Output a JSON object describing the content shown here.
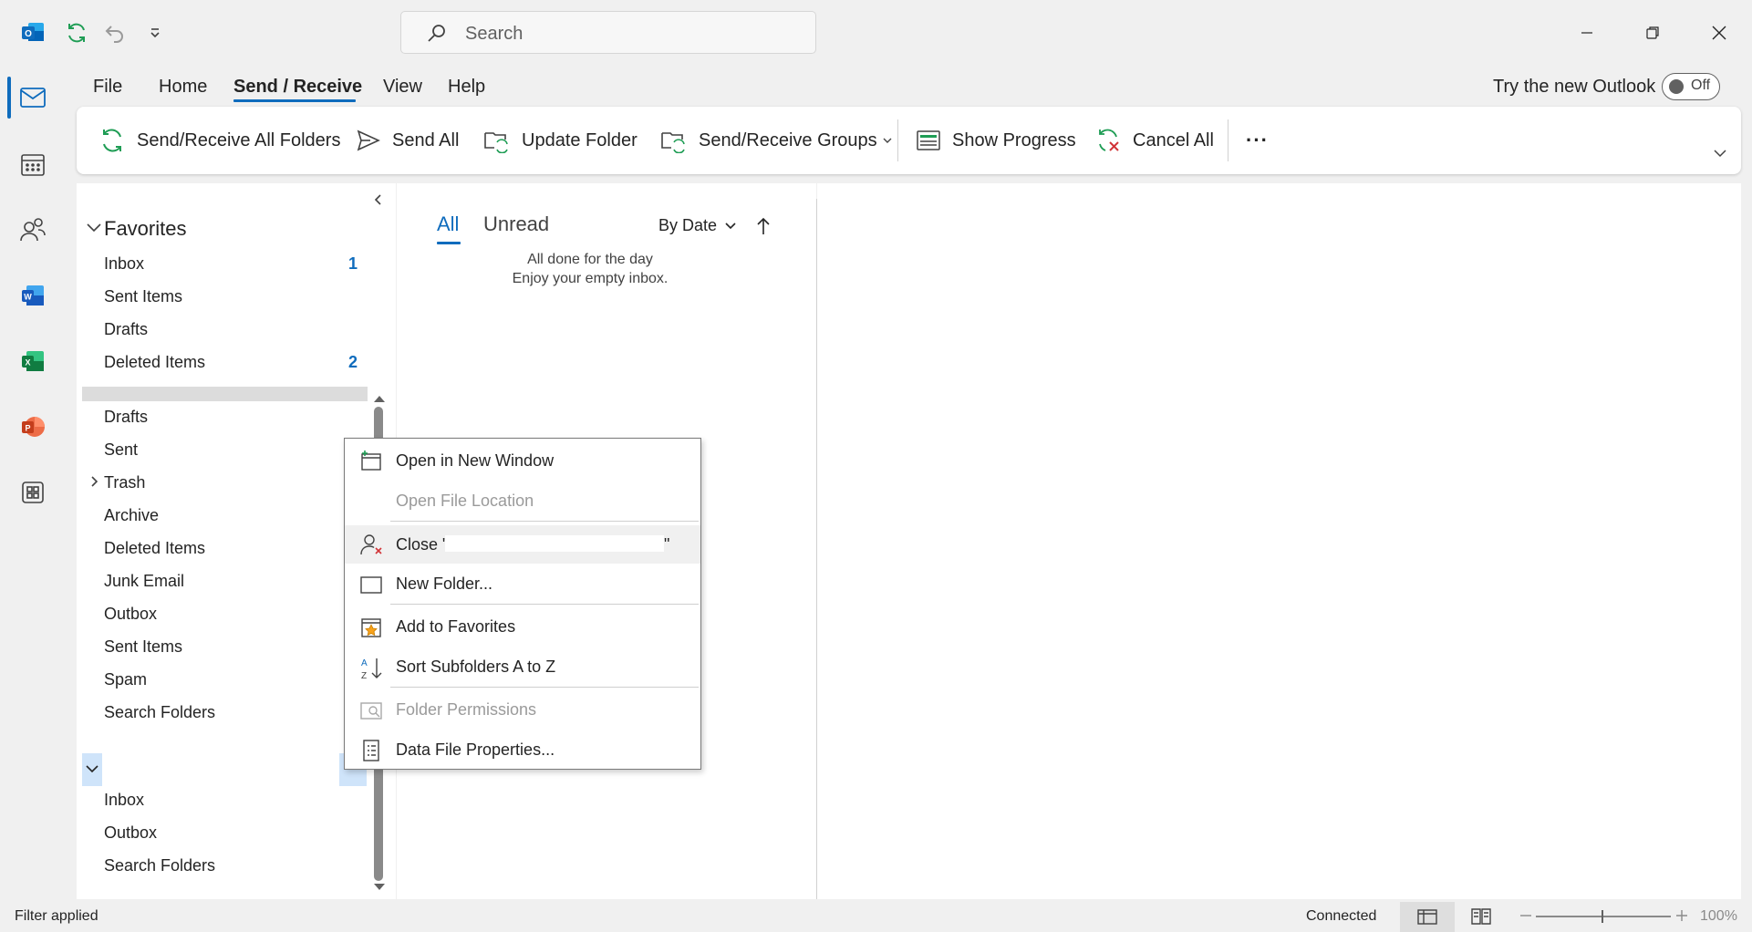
{
  "search": {
    "placeholder": "Search"
  },
  "menu": {
    "tabs": [
      "File",
      "Home",
      "Send / Receive",
      "View",
      "Help"
    ],
    "try_new_outlook": "Try the new Outlook",
    "toggle_label": "Off"
  },
  "ribbon": {
    "send_receive_all": "Send/Receive All Folders",
    "send_all": "Send All",
    "update_folder": "Update Folder",
    "send_receive_groups": "Send/Receive Groups",
    "show_progress": "Show Progress",
    "cancel_all": "Cancel All",
    "more": "···"
  },
  "folders": {
    "favorites_header": "Favorites",
    "favorites": [
      {
        "label": "Inbox",
        "count": "1"
      },
      {
        "label": "Sent Items",
        "count": ""
      },
      {
        "label": "Drafts",
        "count": ""
      },
      {
        "label": "Deleted Items",
        "count": "2"
      }
    ],
    "account1": [
      "Drafts",
      "Sent",
      "Trash",
      "Archive",
      "Deleted Items",
      "Junk Email",
      "Outbox",
      "Sent Items",
      "Spam",
      "Search Folders"
    ],
    "account2": [
      "Inbox",
      "Outbox",
      "Search Folders"
    ]
  },
  "message_list": {
    "tab_all": "All",
    "tab_unread": "Unread",
    "sort": "By Date",
    "empty_line1": "All done for the day",
    "empty_line2": "Enjoy your empty inbox."
  },
  "context_menu": {
    "open_new_window": "Open in New Window",
    "open_file_location": "Open File Location",
    "close_prefix": "Close \"",
    "close_suffix": "\"",
    "new_folder": "New Folder...",
    "add_favorites": "Add to Favorites",
    "sort_subfolders": "Sort Subfolders A to Z",
    "folder_permissions": "Folder Permissions",
    "data_file_properties": "Data File Properties..."
  },
  "status": {
    "filter": "Filter applied",
    "connection": "Connected",
    "zoom": "100%"
  },
  "colors": {
    "accent": "#0f6cbd",
    "background": "#f0f0f0"
  }
}
